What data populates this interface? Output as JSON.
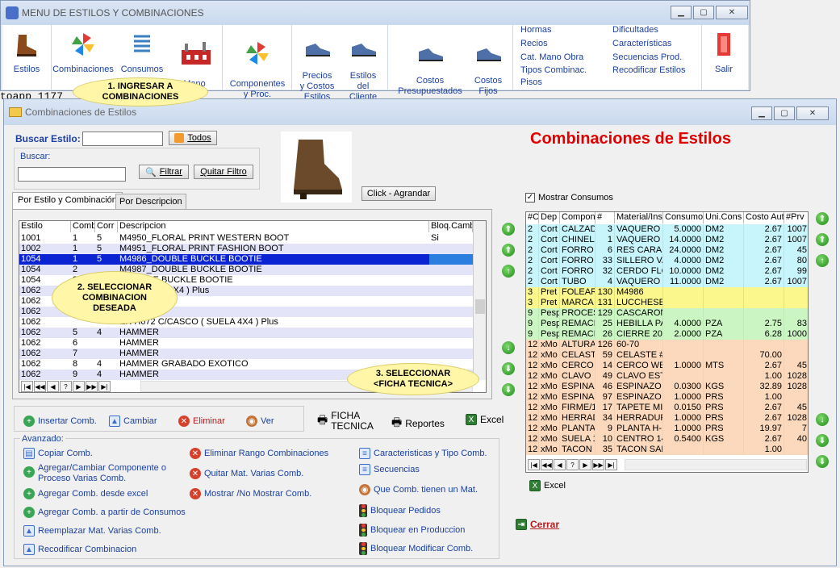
{
  "menu": {
    "title": "MENU DE ESTILOS Y COMBINACIONES",
    "buttons": [
      {
        "label": "Estilos",
        "icon": "boot-icon"
      },
      {
        "label": "Combinaciones",
        "icon": "pinwheel-icon"
      },
      {
        "label": "Consumos",
        "icon": "springs-icon"
      },
      {
        "label": "Mano\nObra",
        "icon": "factory-icon"
      },
      {
        "label": "Componentes\ny Proc.",
        "icon": "pinwheel-icon"
      },
      {
        "label": "Precios\ny Costos\nEstilos",
        "icon": "sneaker-icon"
      },
      {
        "label": "Estilos\ndel\nCliente",
        "icon": "sneaker-icon"
      },
      {
        "label": "Costos\nPresupuestados",
        "icon": "sneaker-icon"
      },
      {
        "label": "Costos\nFijos",
        "icon": "sneaker-icon"
      }
    ],
    "links_col1": [
      "Hormas",
      "Recios",
      "Cat. Mano Obra",
      "Tipos Combinac.",
      "Pisos"
    ],
    "links_col2": [
      "Dificultades",
      "Características",
      "Secuencias Prod.",
      "Recodificar Estilos"
    ],
    "exit": "Salir"
  },
  "bg_text": "toapp 1177",
  "callouts": {
    "c1": "1. INGRESAR A\nCOMBINACIONES",
    "c2": "2. SELECCIONAR\nCOMBINACION\nDESEADA",
    "c3": "3. SELECCIONAR\n<FICHA TECNICA>"
  },
  "win": {
    "title": "Combinaciones de Estilos",
    "heading": "Combinaciones de Estilos",
    "buscar_estilo_label": "Buscar Estilo:",
    "todos": "Todos",
    "buscar_label": "Buscar:",
    "filtrar": "Filtrar",
    "quitar_filtro": "Quitar Filtro",
    "click_agrandar": "Click - Agrandar",
    "tabs": [
      "Por Estilo y Combinación",
      "Por Descripcion"
    ],
    "mostrar_consumos": "Mostrar Consumos",
    "left_grid": {
      "headers": [
        "Estilo",
        "Comb",
        "Corr",
        "Descripcion",
        "Bloq.Cambi"
      ],
      "rows": [
        [
          "1001",
          "1",
          "5",
          "M4950_FLORAL PRINT WESTERN BOOT",
          "Si"
        ],
        [
          "1002",
          "1",
          "5",
          "M4951_FLORAL PRINT FASHION BOOT",
          ""
        ],
        [
          "1054",
          "1",
          "5",
          "M4986_DOUBLE BUCKLE BOOTIE",
          ""
        ],
        [
          "1054",
          "2",
          "",
          "M4987_DOUBLE BUCKLE BOOTIE",
          ""
        ],
        [
          "1054",
          "3",
          "",
          "-DOUBLE BUCKLE BOOTIE",
          ""
        ],
        [
          "1062",
          "",
          "",
          "72  ( SUELA 4X4  ) Plus",
          ""
        ],
        [
          "1062",
          "",
          "",
          "",
          ""
        ],
        [
          "1062",
          "",
          "",
          "",
          ""
        ],
        [
          "1062",
          "",
          "",
          "ER H672  C/CASCO ( SUELA 4X4  ) Plus",
          ""
        ],
        [
          "1062",
          "5",
          "4",
          "HAMMER",
          ""
        ],
        [
          "1062",
          "6",
          "",
          "HAMMER",
          ""
        ],
        [
          "1062",
          "7",
          "",
          "HAMMER",
          ""
        ],
        [
          "1062",
          "8",
          "4",
          "HAMMER GRABADO EXOTICO",
          ""
        ],
        [
          "1062",
          "9",
          "4",
          "HAMMER",
          ""
        ]
      ]
    },
    "right_grid": {
      "headers": [
        "#C",
        "Dep",
        "Compon",
        "#",
        "Material/Ins",
        "Consumo",
        "Uni.Cons",
        "Costo Aut",
        "#Prv"
      ],
      "rows": [
        [
          "2",
          "Cort",
          "CALZAD",
          "3",
          "VAQUERO 1",
          "5.0000",
          "DM2",
          "2.67",
          "1007"
        ],
        [
          "2",
          "Cort",
          "CHINELA",
          "1",
          "VAQUERO 1",
          "14.0000",
          "DM2",
          "2.67",
          "1007"
        ],
        [
          "2",
          "Cort",
          "FORRO",
          "6",
          "RES CARAN",
          "24.0000",
          "DM2",
          "2.67",
          "45"
        ],
        [
          "2",
          "Cort",
          "FORRO A",
          "33",
          "SILLERO VA",
          "4.0000",
          "DM2",
          "2.67",
          "80"
        ],
        [
          "2",
          "Cort",
          "FORRO F",
          "32",
          "CERDO FLO",
          "10.0000",
          "DM2",
          "2.67",
          "99"
        ],
        [
          "2",
          "Cort",
          "TUBO",
          "4",
          "VAQUERO 1",
          "11.0000",
          "DM2",
          "2.67",
          "1007"
        ],
        [
          "3",
          "Pret",
          "FOLEAR",
          "130",
          "M4986",
          "",
          "",
          "",
          ""
        ],
        [
          "3",
          "Pret",
          "MARCA",
          "131",
          "LUCCHESE",
          "",
          "",
          "",
          ""
        ],
        [
          "9",
          "Pesp",
          "PROCES",
          "129",
          "CASCARON",
          "",
          "",
          "",
          ""
        ],
        [
          "9",
          "Pesp",
          "REMACH",
          "25",
          "HEBILLA PA",
          "4.0000",
          "PZA",
          "2.75",
          "83"
        ],
        [
          "9",
          "Pesp",
          "REMACH",
          "26",
          "CIERRE 20",
          "2.0000",
          "PZA",
          "6.28",
          "1000"
        ],
        [
          "12",
          "xMo",
          "ALTURA",
          "126",
          "60-70",
          "",
          "",
          "",
          ""
        ],
        [
          "12",
          "xMo",
          "CELAST",
          "59",
          "CELASTE #",
          "",
          "",
          "70.00",
          ""
        ],
        [
          "12",
          "xMo",
          "CERCO",
          "14",
          "CERCO WE",
          "1.0000",
          "MTS",
          "2.67",
          "45"
        ],
        [
          "12",
          "xMo",
          "CLAVO",
          "49",
          "CLAVO EST",
          "",
          "",
          "1.00",
          "1028"
        ],
        [
          "12",
          "xMo",
          "ESPINAZ",
          "46",
          "ESPINAZO",
          "0.0300",
          "KGS",
          "32.89",
          "1028"
        ],
        [
          "12",
          "xMo",
          "ESPINAZ",
          "97",
          "ESPINAZO",
          "1.0000",
          "PRS",
          "1.00",
          ""
        ],
        [
          "12",
          "xMo",
          "FIRME/1",
          "17",
          "TAPETE MI",
          "0.0150",
          "PRS",
          "2.67",
          "45"
        ],
        [
          "12",
          "xMo",
          "HERRAD",
          "34",
          "HERRADUR",
          "1.0000",
          "PRS",
          "2.67",
          "1028"
        ],
        [
          "12",
          "xMo",
          "PLANTA",
          "9",
          "PLANTA H-",
          "1.0000",
          "PRS",
          "19.97",
          "7"
        ],
        [
          "12",
          "xMo",
          "SUELA 1",
          "10",
          "CENTRO 14",
          "0.5400",
          "KGS",
          "2.67",
          "40"
        ],
        [
          "12",
          "xMo",
          "TACON",
          "35",
          "TACON SAL",
          "",
          "",
          "1.00",
          ""
        ]
      ]
    },
    "actions": {
      "insertar": "Insertar Comb.",
      "cambiar": "Cambiar",
      "eliminar": "Eliminar",
      "ver": "Ver",
      "ficha": "FICHA\nTECNICA",
      "reportes": "Reportes",
      "excel": "Excel",
      "excel2": "Excel",
      "cerrar": "Cerrar"
    },
    "avanzado": {
      "label": "Avanzado:",
      "col1": [
        "Copiar Comb.",
        "Agregar/Cambiar Componente o\nProceso Varias Comb.",
        "Agregar Comb. desde excel",
        "Agregar Comb. a partir de Consumos",
        "Reemplazar Mat. Varias Comb.",
        "Recodificar Combinacion"
      ],
      "col2": [
        "Eliminar Rango Combinaciones",
        "Quitar Mat. Varias Comb.",
        "Mostrar /No Mostrar Comb."
      ],
      "col3": [
        "Caracteristicas y Tipo Comb.",
        "Secuencias",
        "Que Comb. tienen un Mat.",
        "Bloquear Pedidos",
        "Bloquear en Produccion",
        "Bloquear Modificar Comb."
      ]
    }
  },
  "colors": {
    "cyan": "#c8f5fb",
    "yellow": "#fbf78c",
    "green": "#ccf5c4",
    "peach": "#fcd9bd",
    "lavender": "#e4e4f8",
    "selected": "#0a24d4",
    "heading": "#e00000",
    "link": "#1a3fa0"
  }
}
